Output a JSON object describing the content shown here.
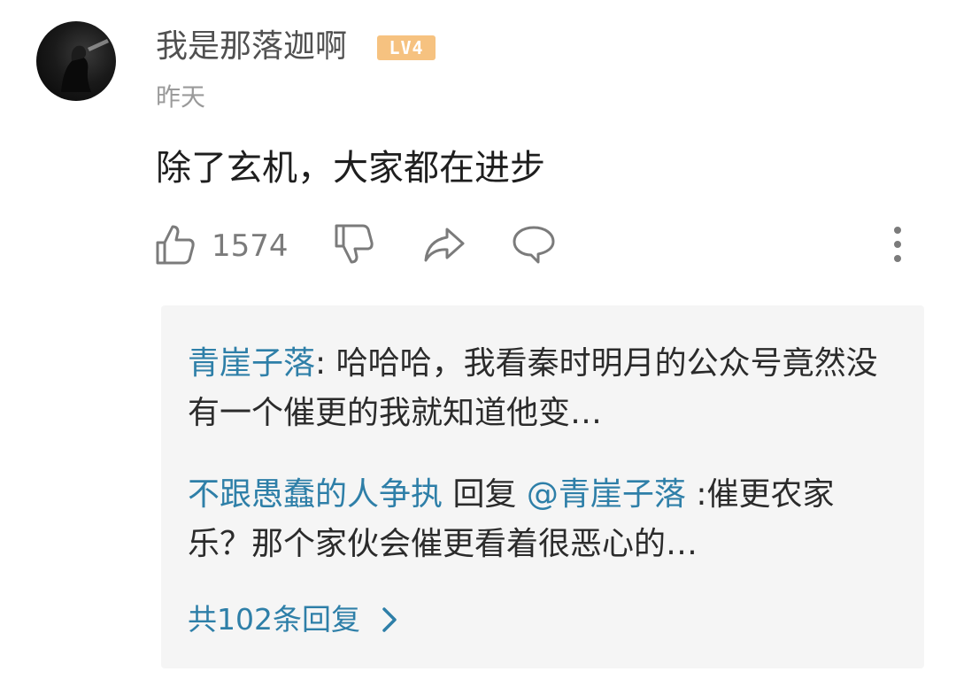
{
  "comment": {
    "username": "我是那落迦啊",
    "level": "LV4",
    "time": "昨天",
    "text": "除了玄机，大家都在进步",
    "likes": "1574"
  },
  "icons": {
    "like": "thumbs-up-icon",
    "dislike": "thumbs-down-icon",
    "share": "share-arrow-icon",
    "comment": "speech-bubble-icon",
    "more": "vertical-dots-icon",
    "chevron": "chevron-right-icon"
  },
  "replies": [
    {
      "author": "青崖子落",
      "separator": ": ",
      "text": "哈哈哈，我看秦时明月的公众号竟然没有一个催更的我就知道他变…"
    },
    {
      "author": "不跟愚蠢的人争执",
      "reply_word": " 回复 ",
      "mention": "@青崖子落",
      "separator": " :",
      "text": "催更农家乐？那个家伙会催更看着很恶心的…"
    }
  ],
  "more_replies": "共102条回复",
  "colors": {
    "link_blue": "#2e7fa8",
    "level_badge": "#f6c280",
    "panel_bg": "#f5f5f5"
  }
}
